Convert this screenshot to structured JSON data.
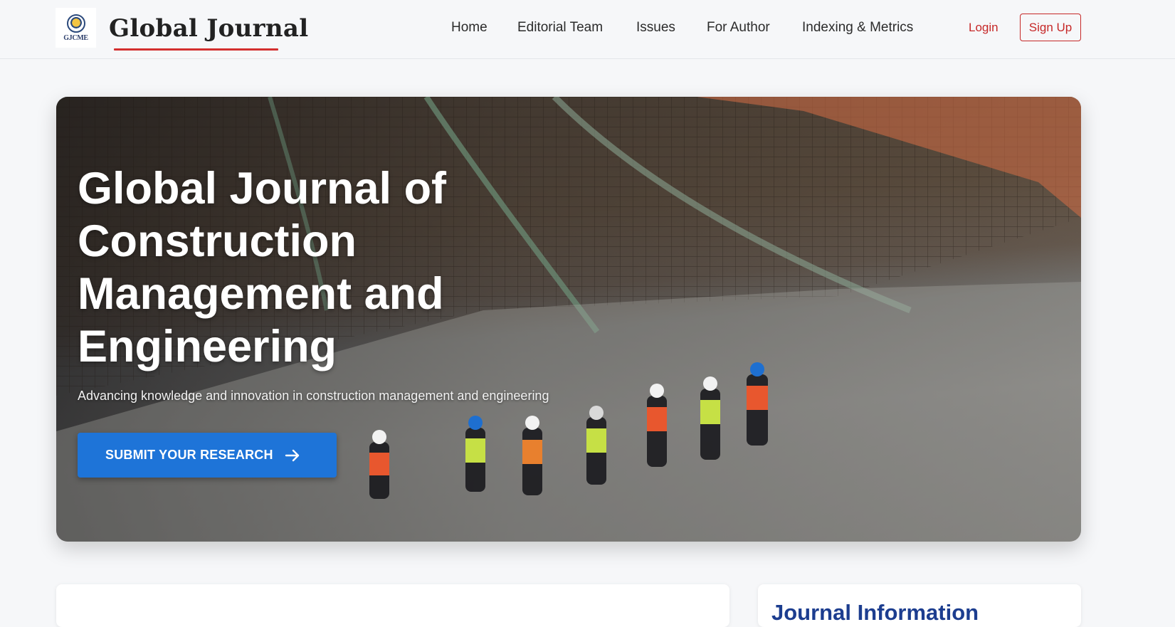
{
  "header": {
    "logo_abbr": "GJCME",
    "brand": "Global Journal",
    "nav": [
      {
        "label": "Home",
        "name": "nav-home"
      },
      {
        "label": "Editorial Team",
        "name": "nav-editorial-team"
      },
      {
        "label": "Issues",
        "name": "nav-issues"
      },
      {
        "label": "For Author",
        "name": "nav-for-author"
      },
      {
        "label": "Indexing & Metrics",
        "name": "nav-indexing-metrics"
      }
    ],
    "login": "Login",
    "signup": "Sign Up"
  },
  "hero": {
    "title": "Global Journal of Construction Management and Engineering",
    "subtitle": "Advancing knowledge and innovation in construction management and engineering",
    "cta": "SUBMIT YOUR RESEARCH",
    "cta_icon": "arrow-right-icon"
  },
  "sidebar_card": {
    "title": "Journal Information"
  },
  "colors": {
    "accent_red": "#d32f2f",
    "cta_blue": "#1e74d8",
    "heading_blue": "#1c3d8f"
  }
}
